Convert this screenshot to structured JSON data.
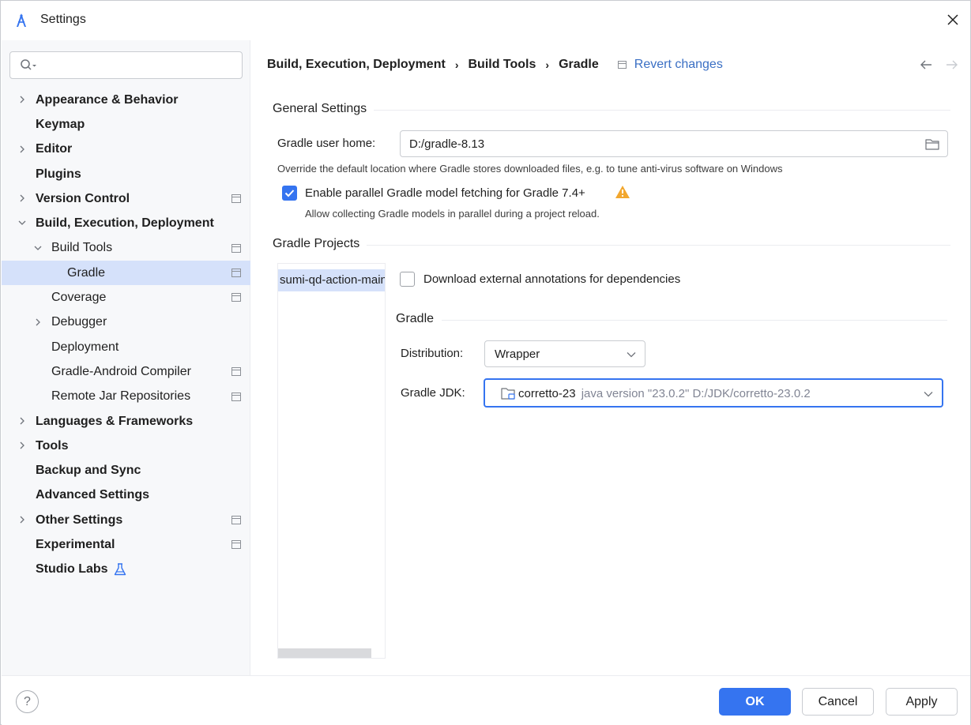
{
  "window": {
    "title": "Settings"
  },
  "search": {
    "placeholder": ""
  },
  "sidebar": {
    "items": [
      {
        "label": "Appearance & Behavior"
      },
      {
        "label": "Keymap"
      },
      {
        "label": "Editor"
      },
      {
        "label": "Plugins"
      },
      {
        "label": "Version Control"
      },
      {
        "label": "Build, Execution, Deployment"
      },
      {
        "label": "Build Tools"
      },
      {
        "label": "Gradle"
      },
      {
        "label": "Coverage"
      },
      {
        "label": "Debugger"
      },
      {
        "label": "Deployment"
      },
      {
        "label": "Gradle-Android Compiler"
      },
      {
        "label": "Remote Jar Repositories"
      },
      {
        "label": "Languages & Frameworks"
      },
      {
        "label": "Tools"
      },
      {
        "label": "Backup and Sync"
      },
      {
        "label": "Advanced Settings"
      },
      {
        "label": "Other Settings"
      },
      {
        "label": "Experimental"
      },
      {
        "label": "Studio Labs"
      }
    ]
  },
  "breadcrumb": {
    "part1": "Build, Execution, Deployment",
    "sep": "›",
    "part2": "Build Tools",
    "part3": "Gradle",
    "revert": "Revert changes"
  },
  "general": {
    "title": "General Settings",
    "user_home_label": "Gradle user home:",
    "user_home_value": "D:/gradle-8.13",
    "user_home_hint": "Override the default location where Gradle stores downloaded files, e.g. to tune anti-virus software on Windows",
    "parallel_label": "Enable parallel Gradle model fetching for Gradle 7.4+",
    "parallel_checked": true,
    "parallel_hint": "Allow collecting Gradle models in parallel during a project reload."
  },
  "projects": {
    "title": "Gradle Projects",
    "items": [
      "sumi-qd-action-main"
    ],
    "download_annotations_label": "Download external annotations for dependencies",
    "download_annotations_checked": false,
    "gradle_section_title": "Gradle",
    "distribution_label": "Distribution:",
    "distribution_value": "Wrapper",
    "jdk_label": "Gradle JDK:",
    "jdk_name": "corretto-23",
    "jdk_detail": "java version \"23.0.2\" D:/JDK/corretto-23.0.2"
  },
  "footer": {
    "help": "?",
    "ok": "OK",
    "cancel": "Cancel",
    "apply": "Apply"
  },
  "colors": {
    "accent": "#3574f0",
    "selection": "#d5e1fa",
    "warning": "#f2a72e",
    "link": "#3a6fc4"
  }
}
